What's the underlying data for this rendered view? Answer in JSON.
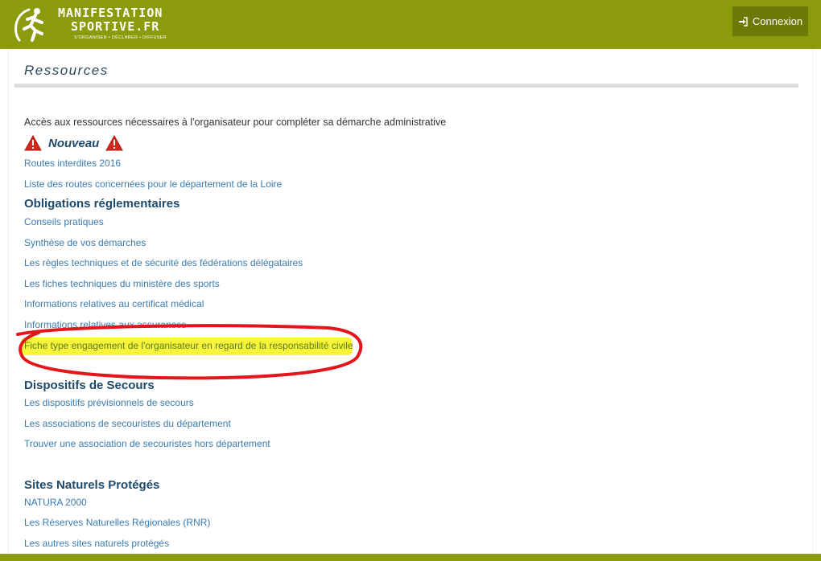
{
  "header": {
    "logo_line1": "MANIFESTATION",
    "logo_line2": "SPORTIVE.FR",
    "logo_tagline": "S'ORGANISER • DÉCLARER • DIFFUSER",
    "login_label": "Connexion",
    "login_icon": "sign-in-icon",
    "brand_color": "#8c9b0c"
  },
  "page": {
    "title": "Ressources",
    "intro": "Accès aux ressources nécessaires à l'organisateur pour compléter sa démarche administrative"
  },
  "nouveau": {
    "label": "Nouveau",
    "icon": "warning-icon",
    "links": [
      "Routes interdites 2016",
      "Liste des routes concernées pour le département de la Loire"
    ]
  },
  "obligations": {
    "title": "Obligations réglementaires",
    "links": [
      "Conseils pratiques",
      "Synthèse de vos démarches",
      "Les règles techniques et de sécurité des fédérations délégataires",
      "Les fiches techniques du ministère des sports",
      "Informations relatives au certificat médical",
      "Informations relatives aux assurances",
      "Fiche type engagement de l'organisateur en regard de la responsabilité civile"
    ]
  },
  "secours": {
    "title": "Dispositifs de Secours",
    "links": [
      "Les dispositifs prévisionnels de secours",
      "Les associations de secouristes du département",
      "Trouver une association de secouristes hors département"
    ]
  },
  "sites": {
    "title": "Sites Naturels Protégés",
    "links": [
      "NATURA 2000",
      "Les Réserves Naturelles Régionales (RNR)",
      "Les autres sites naturels protégés"
    ]
  }
}
